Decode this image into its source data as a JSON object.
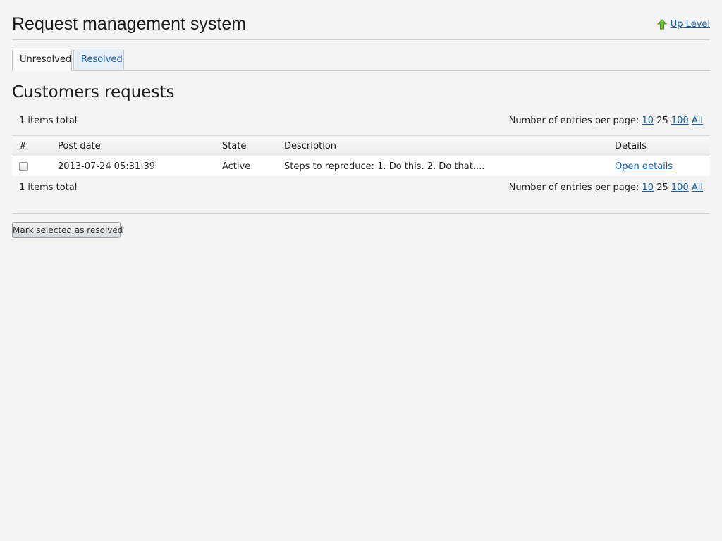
{
  "header": {
    "title": "Request management system",
    "up_level_label": "Up Level"
  },
  "tabs": [
    {
      "label": "Unresolved",
      "active": true
    },
    {
      "label": "Resolved",
      "active": false
    }
  ],
  "section": {
    "title": "Customers requests"
  },
  "pager": {
    "total_text": "1 items total",
    "per_page_label": "Number of entries per page:",
    "options": [
      "10",
      "25",
      "100",
      "All"
    ],
    "current": "25"
  },
  "table": {
    "columns": [
      "#",
      "Post date",
      "State",
      "Description",
      "Details"
    ],
    "rows": [
      {
        "checked": false,
        "post_date": "2013-07-24 05:31:39",
        "state": "Active",
        "description": "Steps to reproduce: 1. Do this. 2. Do that....",
        "details_label": "Open details"
      }
    ]
  },
  "actions": {
    "mark_resolved_label": "Mark selected as resolved"
  },
  "colors": {
    "link": "#1a5ea8",
    "background": "#f4f4f4",
    "up_level_icon": "#6db33f"
  },
  "icons": {
    "up_level": "up-arrow-icon"
  }
}
